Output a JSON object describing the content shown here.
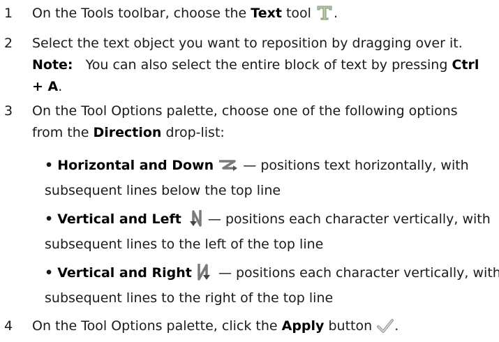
{
  "steps": [
    {
      "number": "1",
      "pre": "On the Tools toolbar, choose the ",
      "bold": "Text",
      "post": " tool",
      "icon": "text-tool-icon"
    },
    {
      "number": "2",
      "text": "Select the text object you want to reposition by dragging over it.",
      "note_label": "Note:",
      "note_text_pre": "You can also select the entire block of text by pressing ",
      "note_bold1": "Ctrl",
      "note_bold2": "+ A",
      "note_end": "."
    },
    {
      "number": "3",
      "line1": "On the Tool Options palette, choose one of the following options",
      "line2_pre": "from the ",
      "line2_bold": "Direction",
      "line2_post": " drop-list:"
    },
    {
      "number": "4",
      "pre": "On the Tool Options palette, click the ",
      "bold": "Apply",
      "post": " button",
      "icon": "apply-checkmark-icon"
    }
  ],
  "options": [
    {
      "bold": "Horizontal and Down",
      "icon": "horizontal-down-icon",
      "desc1": " — positions text horizontally, with",
      "desc2": "subsequent lines below the top line"
    },
    {
      "bold": "Vertical and Left",
      "icon": "vertical-left-icon",
      "desc1": " — positions each character vertically, with",
      "desc2": "subsequent lines to the left of the top line"
    },
    {
      "bold": "Vertical and Right",
      "icon": "vertical-right-icon",
      "desc1": " — positions each character vertically, with",
      "desc2": "subsequent lines to the right of the top line"
    }
  ],
  "bullet_char": "•",
  "period": "."
}
